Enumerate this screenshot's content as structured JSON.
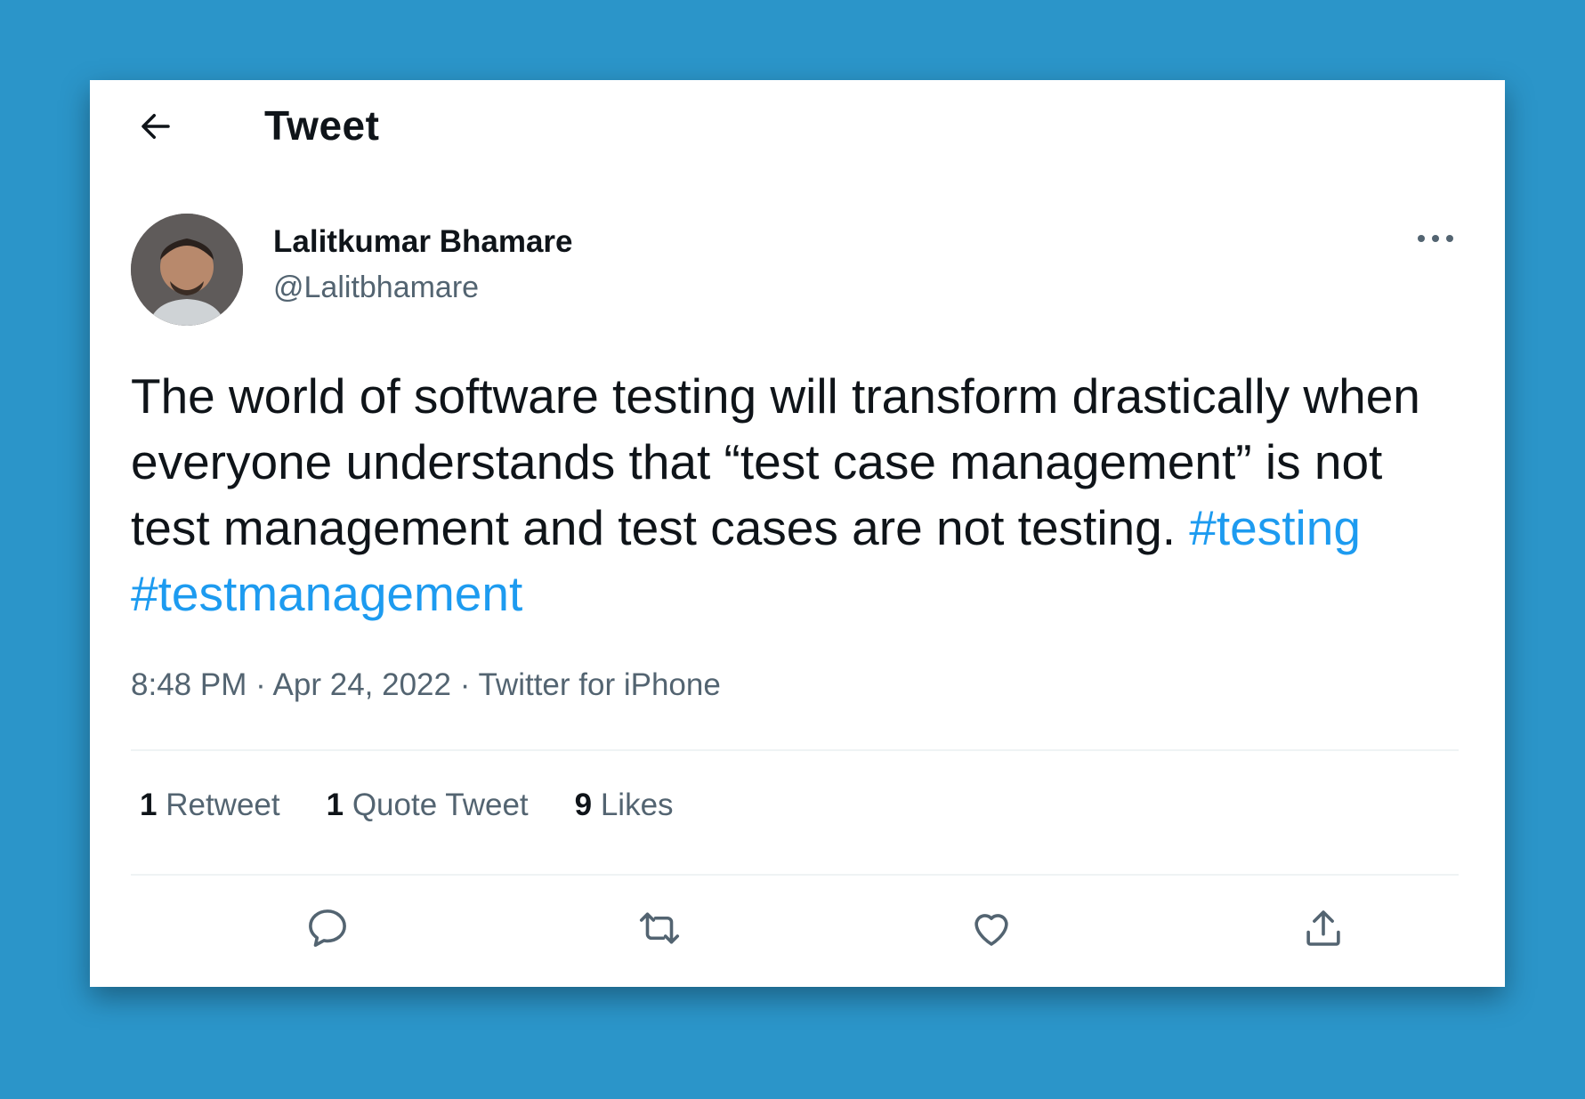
{
  "header": {
    "back_icon": "arrow-left-icon",
    "title": "Tweet"
  },
  "author": {
    "display_name": "Lalitkumar Bhamare",
    "handle": "@Lalitbhamare",
    "avatar_icon": "user-avatar",
    "more_icon": "more-horizontal-icon"
  },
  "tweet": {
    "text": "The world of software testing will transform drastically when everyone understands that “test case management” is not test management and test cases are not testing.",
    "hashtags": [
      "#testing",
      "#testmanagement"
    ],
    "time": "8:48 PM",
    "date": "Apr 24, 2022",
    "source": "Twitter for iPhone"
  },
  "stats": {
    "retweets_count": "1",
    "retweets_label": "Retweet",
    "quotes_count": "1",
    "quotes_label": "Quote Tweet",
    "likes_count": "9",
    "likes_label": "Likes"
  },
  "actions": {
    "reply_icon": "reply-icon",
    "retweet_icon": "retweet-icon",
    "like_icon": "heart-icon",
    "share_icon": "share-icon"
  },
  "colors": {
    "page_background": "#2b95c9",
    "card_background": "#ffffff",
    "text_primary": "#0f1419",
    "text_secondary": "#536471",
    "hashtag": "#1d9bf0",
    "divider": "#eff3f4"
  }
}
